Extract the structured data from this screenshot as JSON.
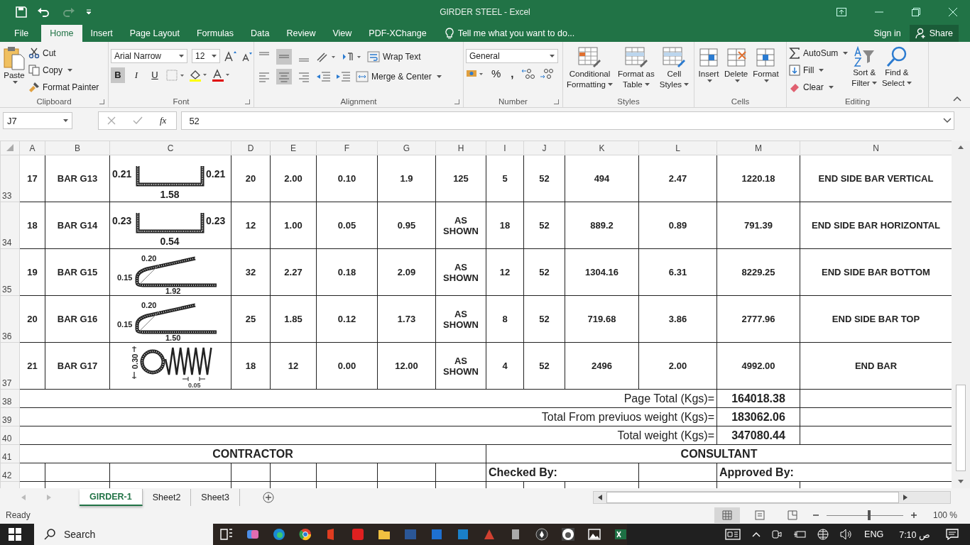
{
  "window": {
    "title": "GIRDER STEEL - Excel"
  },
  "ribbon_tabs": [
    {
      "label": "File",
      "selected": false
    },
    {
      "label": "Home",
      "selected": true
    },
    {
      "label": "Insert",
      "selected": false
    },
    {
      "label": "Page Layout",
      "selected": false
    },
    {
      "label": "Formulas",
      "selected": false
    },
    {
      "label": "Data",
      "selected": false
    },
    {
      "label": "Review",
      "selected": false
    },
    {
      "label": "View",
      "selected": false
    },
    {
      "label": "PDF-XChange",
      "selected": false
    }
  ],
  "tell_me": "Tell me what you want to do...",
  "account": {
    "sign_in": "Sign in",
    "share": "Share"
  },
  "clipboard": {
    "paste": "Paste",
    "cut": "Cut",
    "copy": "Copy",
    "painter": "Format Painter",
    "label": "Clipboard"
  },
  "font": {
    "name": "Arial Narrow",
    "size": "12",
    "label": "Font",
    "bold": "B",
    "italic": "I",
    "underline": "U"
  },
  "alignment": {
    "wrap": "Wrap Text",
    "merge": "Merge & Center",
    "label": "Alignment"
  },
  "number": {
    "format": "General",
    "percent": "%",
    "comma": ",",
    "label": "Number"
  },
  "styles": {
    "items": [
      [
        "Conditional",
        "Formatting"
      ],
      [
        "Format as",
        "Table"
      ],
      [
        "Cell",
        "Styles"
      ]
    ],
    "label": "Styles"
  },
  "cells": {
    "items": [
      "Insert",
      "Delete",
      "Format"
    ],
    "label": "Cells"
  },
  "editing": {
    "autosum": "AutoSum",
    "fill": "Fill",
    "clear": "Clear",
    "sort": [
      "Sort &",
      "Filter"
    ],
    "find": [
      "Find &",
      "Select"
    ],
    "label": "Editing"
  },
  "formula_bar": {
    "name_box": "J7",
    "fx": "fx",
    "value": "52"
  },
  "sheet": {
    "columns": [
      "A",
      "B",
      "C",
      "D",
      "E",
      "F",
      "G",
      "H",
      "I",
      "J",
      "K",
      "L",
      "M",
      "N"
    ],
    "rows": [
      {
        "row": "33",
        "values": [
          "17",
          "BAR G13",
          "20",
          "2.00",
          "0.10",
          "1.9",
          "125",
          "5",
          "52",
          "494",
          "2.47",
          "1220.18",
          "END SIDE BAR VERTICAL"
        ],
        "sketch": {
          "kind": "channel",
          "labels": [
            "0.21",
            "0.21",
            "1.58"
          ]
        }
      },
      {
        "row": "34",
        "values": [
          "18",
          "BAR G14",
          "12",
          "1.00",
          "0.05",
          "0.95",
          "AS SHOWN",
          "18",
          "52",
          "889.2",
          "0.89",
          "791.39",
          "END SIDE BAR HORIZONTAL"
        ],
        "sketch": {
          "kind": "channel",
          "labels": [
            "0.23",
            "0.23",
            "0.54"
          ]
        }
      },
      {
        "row": "35",
        "values": [
          "19",
          "BAR G15",
          "32",
          "2.27",
          "0.18",
          "2.09",
          "AS SHOWN",
          "12",
          "52",
          "1304.16",
          "6.31",
          "8229.25",
          "END SIDE BAR BOTTOM"
        ],
        "sketch": {
          "kind": "hook",
          "labels": [
            "0.20",
            "0.15",
            "1.92"
          ]
        }
      },
      {
        "row": "36",
        "values": [
          "20",
          "BAR G16",
          "25",
          "1.85",
          "0.12",
          "1.73",
          "AS SHOWN",
          "8",
          "52",
          "719.68",
          "3.86",
          "2777.96",
          "END SIDE BAR TOP"
        ],
        "sketch": {
          "kind": "hook",
          "labels": [
            "0.20",
            "0.15",
            "1.50"
          ]
        }
      },
      {
        "row": "37",
        "values": [
          "21",
          "BAR G17",
          "18",
          "12",
          "0.00",
          "12.00",
          "AS SHOWN",
          "4",
          "52",
          "2496",
          "2.00",
          "4992.00",
          "END BAR"
        ],
        "sketch": {
          "kind": "ring",
          "labels": [
            "0.30",
            "0.05"
          ]
        }
      }
    ],
    "totals": [
      {
        "row": "38",
        "label": "Page Total (Kgs)=",
        "value": "164018.38"
      },
      {
        "row": "39",
        "label": "Total From previuos weight (Kgs)=",
        "value": "183062.06"
      },
      {
        "row": "40",
        "label": "Total weight (Kgs)=",
        "value": "347080.44"
      }
    ],
    "parties": {
      "row": "41",
      "contractor": "CONTRACTOR",
      "consultant": "CONSULTANT"
    },
    "approvals": {
      "row": "42",
      "checked": "Checked By:",
      "approved": "Approved By:"
    }
  },
  "sheet_tabs": [
    {
      "label": "GIRDER-1",
      "selected": true
    },
    {
      "label": "Sheet2",
      "selected": false
    },
    {
      "label": "Sheet3",
      "selected": false
    }
  ],
  "status_bar": {
    "state": "Ready",
    "zoom": "100 %",
    "zoom_slider": {
      "level": 0.56
    }
  },
  "taskbar": {
    "search": "Search",
    "language": "ENG",
    "time": "7:10 ص"
  }
}
